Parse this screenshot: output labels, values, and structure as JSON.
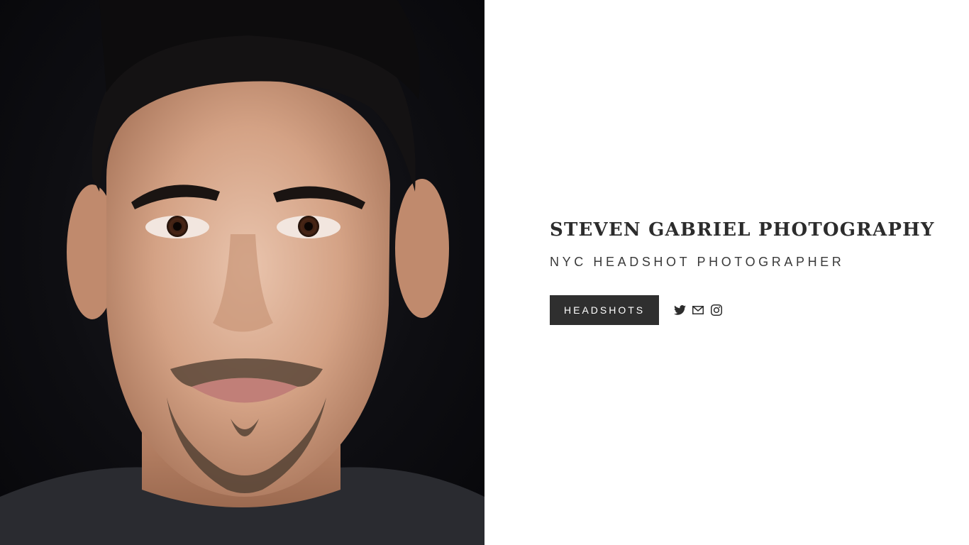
{
  "site": {
    "title": "STEVEN GABRIEL PHOTOGRAPHY",
    "subtitle": "NYC HEADSHOT PHOTOGRAPHER"
  },
  "nav": {
    "primary_button_label": "HEADSHOTS"
  },
  "social": [
    {
      "icon": "twitter-icon"
    },
    {
      "icon": "email-icon"
    },
    {
      "icon": "instagram-icon"
    }
  ],
  "colors": {
    "background": "#ffffff",
    "text": "#2c2c2c",
    "button_bg": "#2f2f2f",
    "button_text": "#ffffff",
    "photo_bg": "#0e0e12"
  }
}
